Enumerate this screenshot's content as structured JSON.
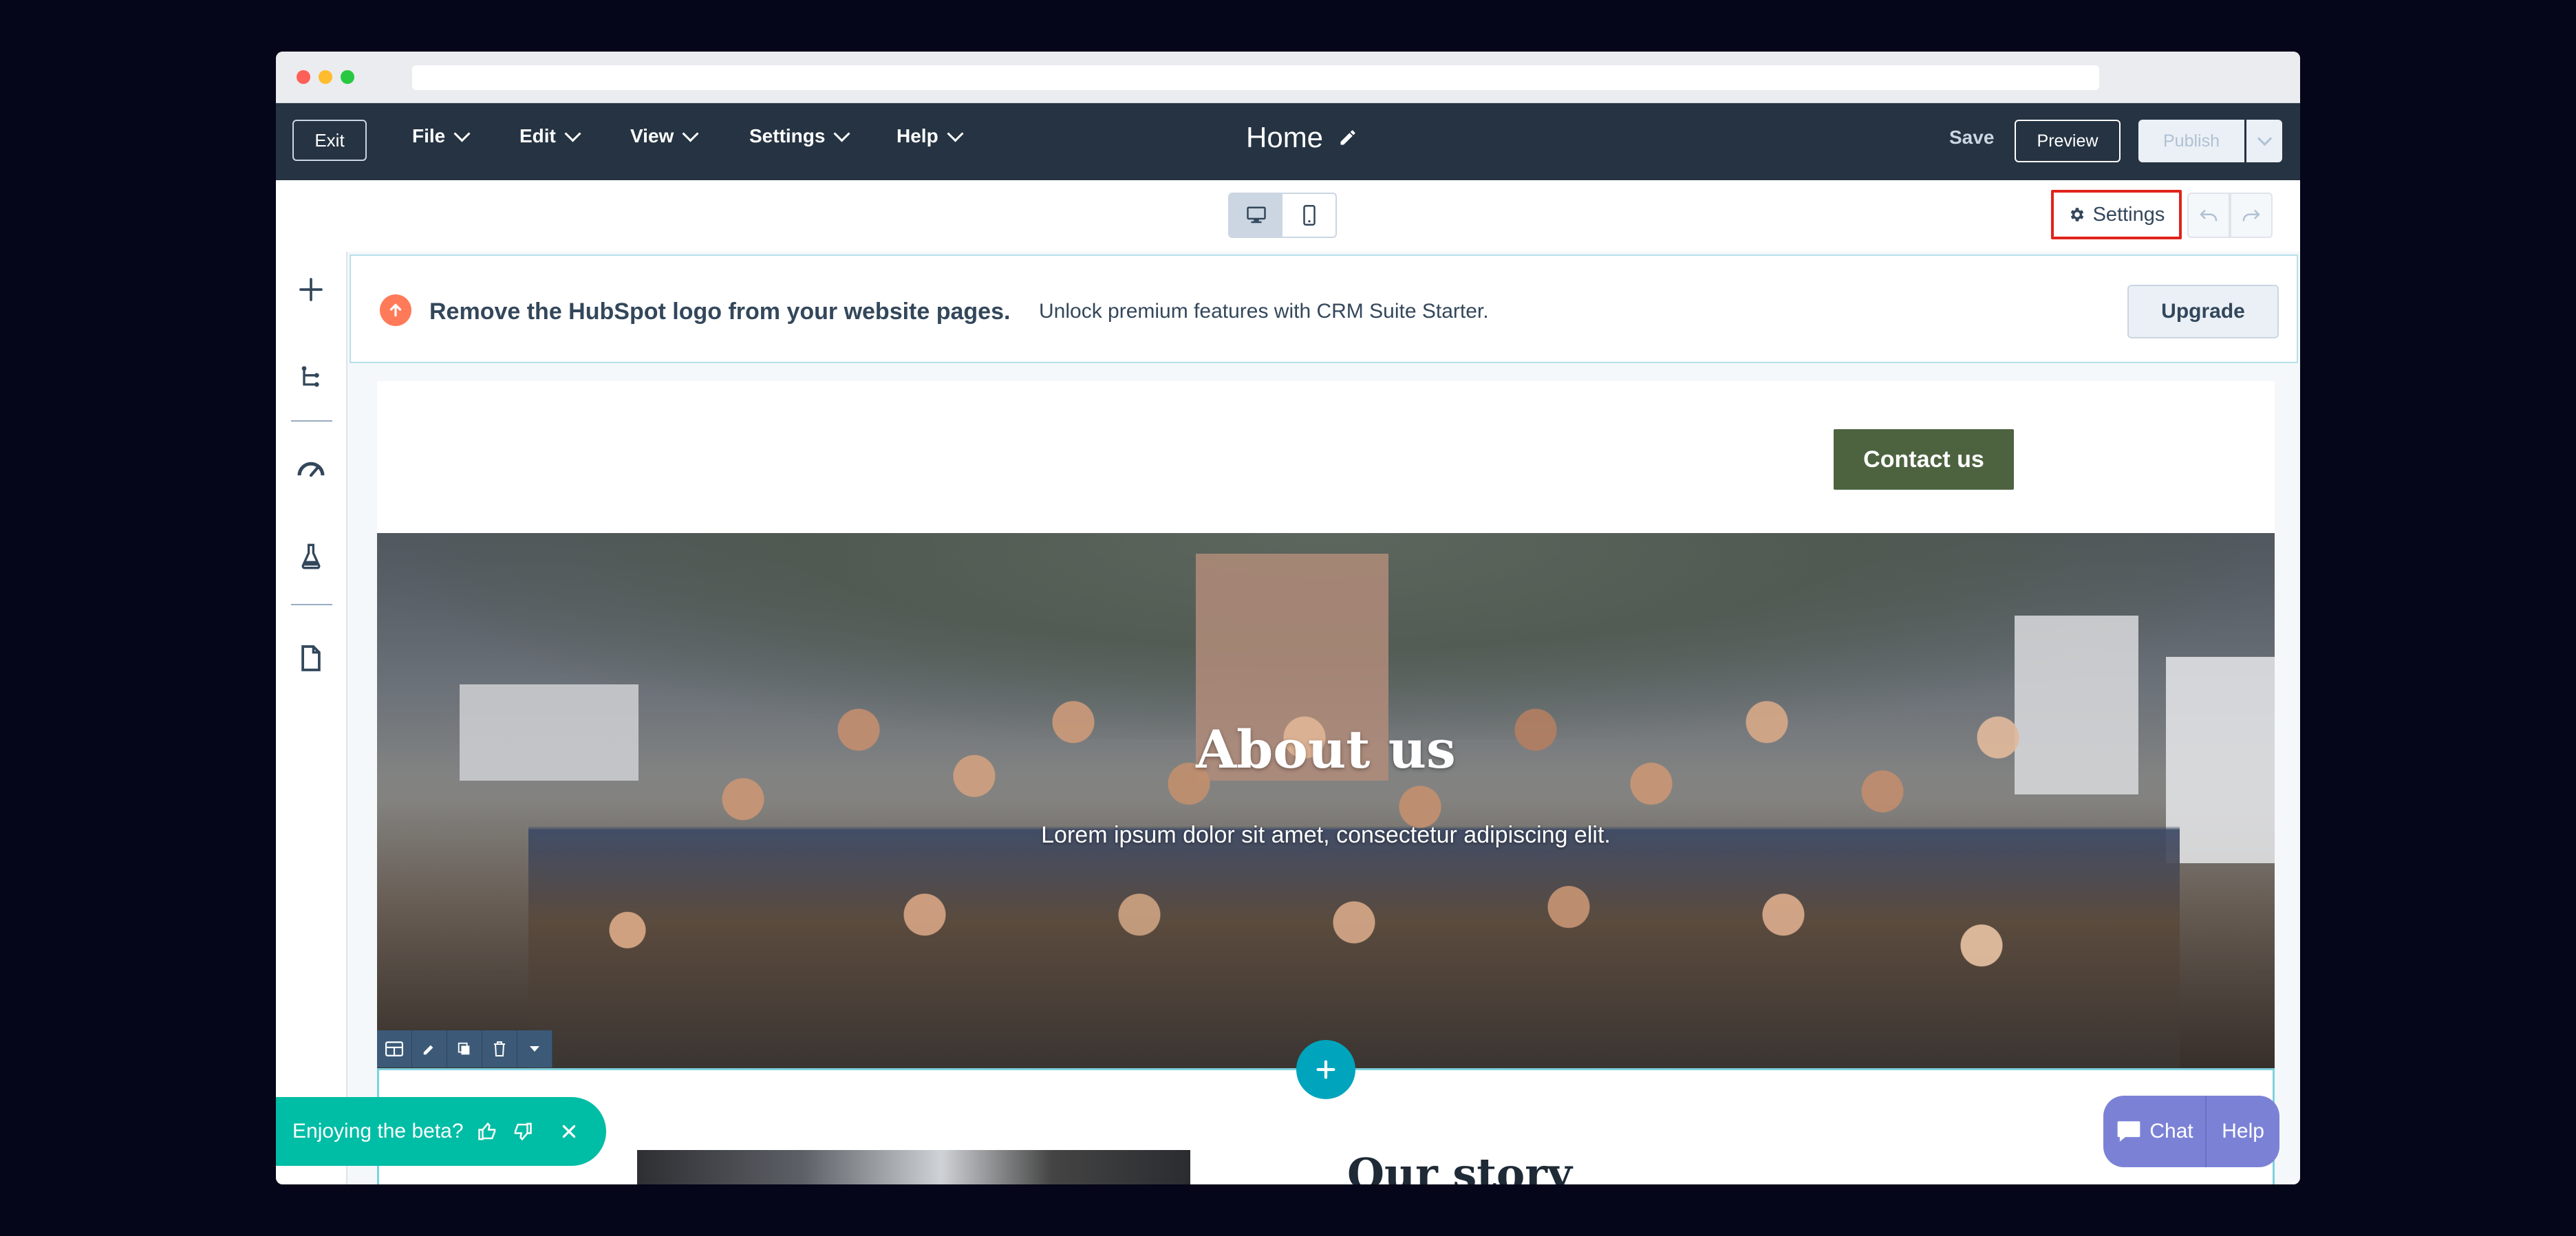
{
  "window": {
    "url": ""
  },
  "topbar": {
    "exit_label": "Exit",
    "menu": [
      "File",
      "Edit",
      "View",
      "Settings",
      "Help"
    ],
    "page_title": "Home",
    "save_label": "Save",
    "preview_label": "Preview",
    "publish_label": "Publish"
  },
  "toolbar": {
    "settings_label": "Settings"
  },
  "banner": {
    "title": "Remove the HubSpot logo from your website pages.",
    "subtitle": "Unlock premium features with CRM Suite Starter.",
    "upgrade_label": "Upgrade"
  },
  "page": {
    "contact_label": "Contact us",
    "hero_title": "About us",
    "hero_subtitle": "Lorem ipsum dolor sit amet, consectetur adipiscing elit.",
    "story_title": "Our story"
  },
  "beta": {
    "text": "Enjoying the beta?"
  },
  "chat": {
    "chat_label": "Chat",
    "help_label": "Help"
  },
  "colors": {
    "editor_dark": "#253342",
    "accent_teal": "#00a4bd",
    "highlight_red": "#e0231b",
    "contact_green": "#4d6340",
    "beta_green": "#00bda5",
    "chat_purple": "#7b82d6"
  }
}
